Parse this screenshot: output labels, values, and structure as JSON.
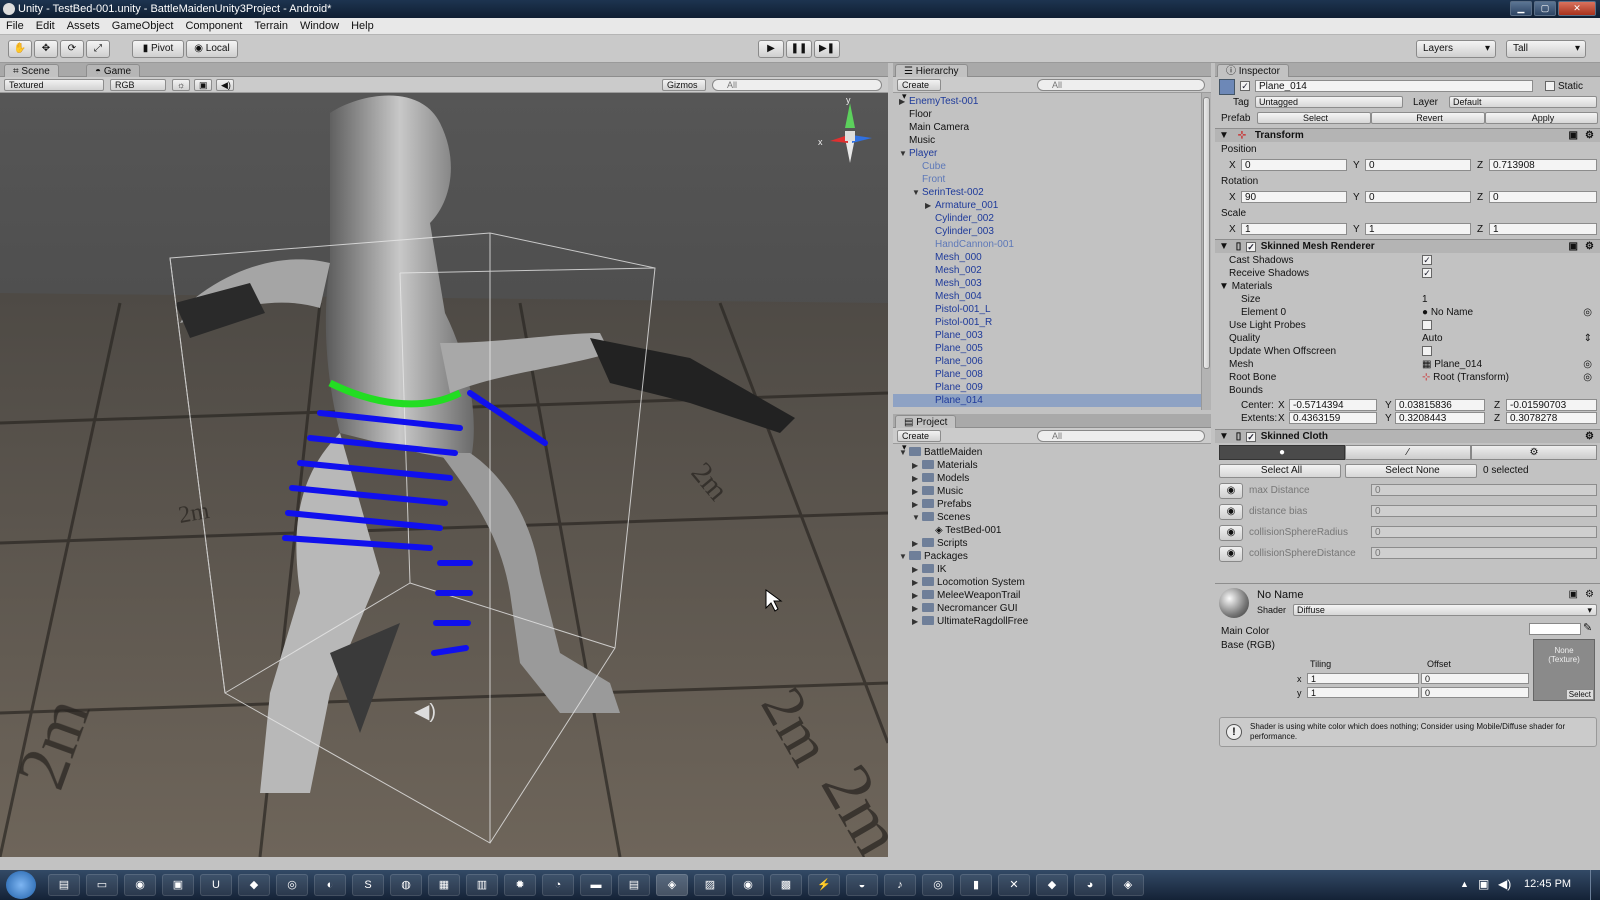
{
  "window": {
    "title": "Unity - TestBed-001.unity - BattleMaidenUnity3Project - Android*",
    "buttons": [
      "▁",
      "▢",
      "✕"
    ]
  },
  "menu": [
    "File",
    "Edit",
    "Assets",
    "GameObject",
    "Component",
    "Terrain",
    "Window",
    "Help"
  ],
  "toolbar": {
    "pivot": "Pivot",
    "local": "Local",
    "layers": "Layers",
    "layout": "Tall",
    "play": "▶",
    "pause": "❚❚",
    "step": "▶❚"
  },
  "scene": {
    "tab_scene": "Scene",
    "tab_game": "Game",
    "render_mode": "Textured",
    "color_mode": "RGB",
    "gizmos": "Gizmos",
    "search_placeholder": "All",
    "gizmo_labels": {
      "x": "x",
      "y": "y"
    },
    "floor_text": "2m"
  },
  "hierarchy": {
    "tab": "Hierarchy",
    "create": "Create",
    "search_placeholder": "All",
    "items": [
      {
        "label": "EnemyTest-001",
        "indent": 0,
        "arrow": "▶",
        "color": "blue"
      },
      {
        "label": "Floor",
        "indent": 0,
        "arrow": "",
        "color": "black"
      },
      {
        "label": "Main Camera",
        "indent": 0,
        "arrow": "",
        "color": "black"
      },
      {
        "label": "Music",
        "indent": 0,
        "arrow": "",
        "color": "black"
      },
      {
        "label": "Player",
        "indent": 0,
        "arrow": "▼",
        "color": "blue"
      },
      {
        "label": "Cube",
        "indent": 1,
        "arrow": "",
        "color": "lightblue"
      },
      {
        "label": "Front",
        "indent": 1,
        "arrow": "",
        "color": "lightblue"
      },
      {
        "label": "SerinTest-002",
        "indent": 1,
        "arrow": "▼",
        "color": "blue"
      },
      {
        "label": "Armature_001",
        "indent": 2,
        "arrow": "▶",
        "color": "blue"
      },
      {
        "label": "Cylinder_002",
        "indent": 2,
        "arrow": "",
        "color": "blue"
      },
      {
        "label": "Cylinder_003",
        "indent": 2,
        "arrow": "",
        "color": "blue"
      },
      {
        "label": "HandCannon-001",
        "indent": 2,
        "arrow": "",
        "color": "lightblue"
      },
      {
        "label": "Mesh_000",
        "indent": 2,
        "arrow": "",
        "color": "blue"
      },
      {
        "label": "Mesh_002",
        "indent": 2,
        "arrow": "",
        "color": "blue"
      },
      {
        "label": "Mesh_003",
        "indent": 2,
        "arrow": "",
        "color": "blue"
      },
      {
        "label": "Mesh_004",
        "indent": 2,
        "arrow": "",
        "color": "blue"
      },
      {
        "label": "Pistol-001_L",
        "indent": 2,
        "arrow": "",
        "color": "blue"
      },
      {
        "label": "Pistol-001_R",
        "indent": 2,
        "arrow": "",
        "color": "blue"
      },
      {
        "label": "Plane_003",
        "indent": 2,
        "arrow": "",
        "color": "blue"
      },
      {
        "label": "Plane_005",
        "indent": 2,
        "arrow": "",
        "color": "blue"
      },
      {
        "label": "Plane_006",
        "indent": 2,
        "arrow": "",
        "color": "blue"
      },
      {
        "label": "Plane_008",
        "indent": 2,
        "arrow": "",
        "color": "blue"
      },
      {
        "label": "Plane_009",
        "indent": 2,
        "arrow": "",
        "color": "blue"
      },
      {
        "label": "Plane_014",
        "indent": 2,
        "arrow": "",
        "color": "blue",
        "selected": true
      }
    ]
  },
  "project": {
    "tab": "Project",
    "create": "Create",
    "search_placeholder": "All",
    "items": [
      {
        "label": "BattleMaiden",
        "indent": 0,
        "arrow": "▼",
        "type": "folder"
      },
      {
        "label": "Materials",
        "indent": 1,
        "arrow": "▶",
        "type": "folder"
      },
      {
        "label": "Models",
        "indent": 1,
        "arrow": "▶",
        "type": "folder"
      },
      {
        "label": "Music",
        "indent": 1,
        "arrow": "▶",
        "type": "folder"
      },
      {
        "label": "Prefabs",
        "indent": 1,
        "arrow": "▶",
        "type": "folder"
      },
      {
        "label": "Scenes",
        "indent": 1,
        "arrow": "▼",
        "type": "folder"
      },
      {
        "label": "TestBed-001",
        "indent": 2,
        "arrow": "",
        "type": "scene"
      },
      {
        "label": "Scripts",
        "indent": 1,
        "arrow": "▶",
        "type": "folder"
      },
      {
        "label": "Packages",
        "indent": 0,
        "arrow": "▼",
        "type": "folder"
      },
      {
        "label": "IK",
        "indent": 1,
        "arrow": "▶",
        "type": "folder"
      },
      {
        "label": "Locomotion System",
        "indent": 1,
        "arrow": "▶",
        "type": "folder"
      },
      {
        "label": "MeleeWeaponTrail",
        "indent": 1,
        "arrow": "▶",
        "type": "folder"
      },
      {
        "label": "Necromancer GUI",
        "indent": 1,
        "arrow": "▶",
        "type": "folder"
      },
      {
        "label": "UltimateRagdollFree",
        "indent": 1,
        "arrow": "▶",
        "type": "folder"
      }
    ]
  },
  "inspector": {
    "tab": "Inspector",
    "object_name": "Plane_014",
    "static": "Static",
    "tag_label": "Tag",
    "tag_value": "Untagged",
    "layer_label": "Layer",
    "layer_value": "Default",
    "prefab_label": "Prefab",
    "prefab_select": "Select",
    "prefab_revert": "Revert",
    "prefab_apply": "Apply",
    "transform": {
      "title": "Transform",
      "position_label": "Position",
      "position": {
        "x": "0",
        "y": "0",
        "z": "0.713908"
      },
      "rotation_label": "Rotation",
      "rotation": {
        "x": "90",
        "y": "0",
        "z": "0"
      },
      "scale_label": "Scale",
      "scale": {
        "x": "1",
        "y": "1",
        "z": "1"
      },
      "axis_x": "X",
      "axis_y": "Y",
      "axis_z": "Z"
    },
    "smr": {
      "title": "Skinned Mesh Renderer",
      "cast_shadows": "Cast Shadows",
      "receive_shadows": "Receive Shadows",
      "materials": "Materials",
      "size": "Size",
      "size_value": "1",
      "element0": "Element 0",
      "element0_value": "No Name",
      "use_light_probes": "Use Light Probes",
      "quality": "Quality",
      "quality_value": "Auto",
      "update_offscreen": "Update When Offscreen",
      "mesh": "Mesh",
      "mesh_value": "Plane_014",
      "root_bone": "Root Bone",
      "root_bone_value": "Root (Transform)",
      "bounds": "Bounds",
      "center": "Center:",
      "center_x": "-0.5714394",
      "center_y": "0.03815836",
      "center_z": "-0.01590703",
      "extents": "Extents:",
      "extents_x": "0.4363159",
      "extents_y": "0.3208443",
      "extents_z": "0.3078278"
    },
    "cloth": {
      "title": "Skinned Cloth",
      "select_all": "Select All",
      "select_none": "Select None",
      "selected_count": "0 selected",
      "props": [
        {
          "label": "max Distance",
          "value": "0"
        },
        {
          "label": "distance bias",
          "value": "0"
        },
        {
          "label": "collisionSphereRadius",
          "value": "0"
        },
        {
          "label": "collisionSphereDistance",
          "value": "0"
        }
      ]
    },
    "material": {
      "name": "No Name",
      "shader_label": "Shader",
      "shader_value": "Diffuse",
      "main_color": "Main Color",
      "base": "Base (RGB)",
      "tiling": "Tiling",
      "offset": "Offset",
      "x": "x",
      "y": "y",
      "tiling_x": "1",
      "tiling_y": "1",
      "offset_x": "0",
      "offset_y": "0",
      "texture": "None\n(Texture)",
      "texture_select": "Select",
      "warning": "Shader is using white color which does nothing; Consider using Mobile/Diffuse shader for performance."
    }
  },
  "taskbar": {
    "time": "12:45 PM",
    "tray_arrow": "▲"
  },
  "colors": {
    "accent_selection": "#8ea2c4",
    "cloth_vertices": "#1010ee",
    "cloth_fixed": "#22dd22"
  }
}
